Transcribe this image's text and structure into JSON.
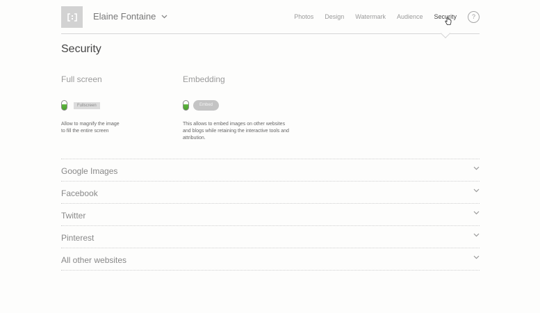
{
  "header": {
    "logo_text": "[:]",
    "account_name": "Elaine Fontaine",
    "nav": [
      {
        "label": "Photos",
        "active": false
      },
      {
        "label": "Design",
        "active": false
      },
      {
        "label": "Watermark",
        "active": false
      },
      {
        "label": "Audience",
        "active": false
      },
      {
        "label": "Security",
        "active": true
      }
    ],
    "help_label": "?"
  },
  "page": {
    "title": "Security"
  },
  "options": {
    "fullscreen": {
      "title": "Full screen",
      "tag": "Fullscreen",
      "desc_line1": "Allow to magnify the image",
      "desc_line2": "to fill the entire screen",
      "enabled": true
    },
    "embedding": {
      "title": "Embedding",
      "tag": "Embed",
      "desc_line1": "This allows to embed images on other websites",
      "desc_line2": "and blogs while retaining the interactive tools and",
      "desc_line3": "attribution.",
      "enabled": true
    }
  },
  "sections": [
    {
      "label": "Google Images"
    },
    {
      "label": "Facebook"
    },
    {
      "label": "Twitter"
    },
    {
      "label": "Pinterest"
    },
    {
      "label": "All other websites"
    }
  ],
  "colors": {
    "toggle_on": "#4aa02e",
    "divider": "#d6d6d6"
  }
}
